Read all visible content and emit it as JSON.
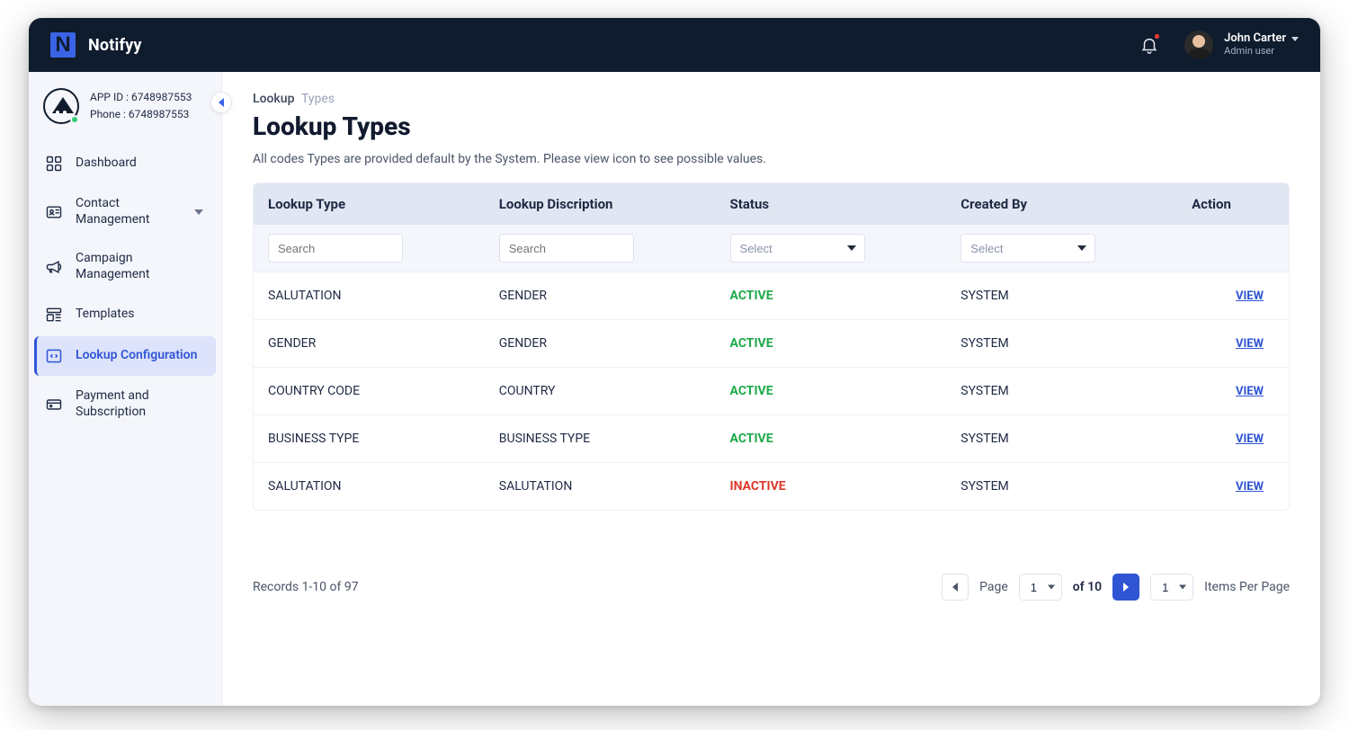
{
  "brand": {
    "name": "Notifyy"
  },
  "user": {
    "name": "John Carter",
    "role": "Admin user"
  },
  "appInfo": {
    "appIdLabel": "APP ID : 6748987553",
    "phoneLabel": "Phone : 6748987553"
  },
  "sidebar": {
    "items": [
      {
        "label": "Dashboard"
      },
      {
        "label": "Contact Management"
      },
      {
        "label": "Campaign Management"
      },
      {
        "label": "Templates"
      },
      {
        "label": "Lookup Configuration"
      },
      {
        "label": "Payment and Subscription"
      }
    ]
  },
  "breadcrumb": {
    "part1": "Lookup",
    "part2": "Types"
  },
  "page": {
    "title": "Lookup Types",
    "help": "All codes Types are provided default by the System. Please view icon  to see possible values."
  },
  "table": {
    "headers": {
      "type": "Lookup Type",
      "desc": "Lookup Discription",
      "status": "Status",
      "by": "Created By",
      "action": "Action"
    },
    "filters": {
      "searchPlaceholder": "Search",
      "selectPlaceholder": "Select"
    },
    "viewLabel": "VIEW",
    "rows": [
      {
        "type": "SALUTATION",
        "desc": "GENDER",
        "status": "ACTIVE",
        "by": "SYSTEM"
      },
      {
        "type": "GENDER",
        "desc": "GENDER",
        "status": "ACTIVE",
        "by": "SYSTEM"
      },
      {
        "type": "COUNTRY CODE",
        "desc": "COUNTRY",
        "status": "ACTIVE",
        "by": "SYSTEM"
      },
      {
        "type": "BUSINESS TYPE",
        "desc": "BUSINESS TYPE",
        "status": "ACTIVE",
        "by": "SYSTEM"
      },
      {
        "type": "SALUTATION",
        "desc": "SALUTATION",
        "status": "INACTIVE",
        "by": "SYSTEM"
      }
    ]
  },
  "footer": {
    "recordsText": "Records 1-10 of 97",
    "pageLabel": "Page",
    "pageValue": "1",
    "ofText": "of 10",
    "ippValue": "1",
    "ippLabel": "Items Per Page"
  }
}
